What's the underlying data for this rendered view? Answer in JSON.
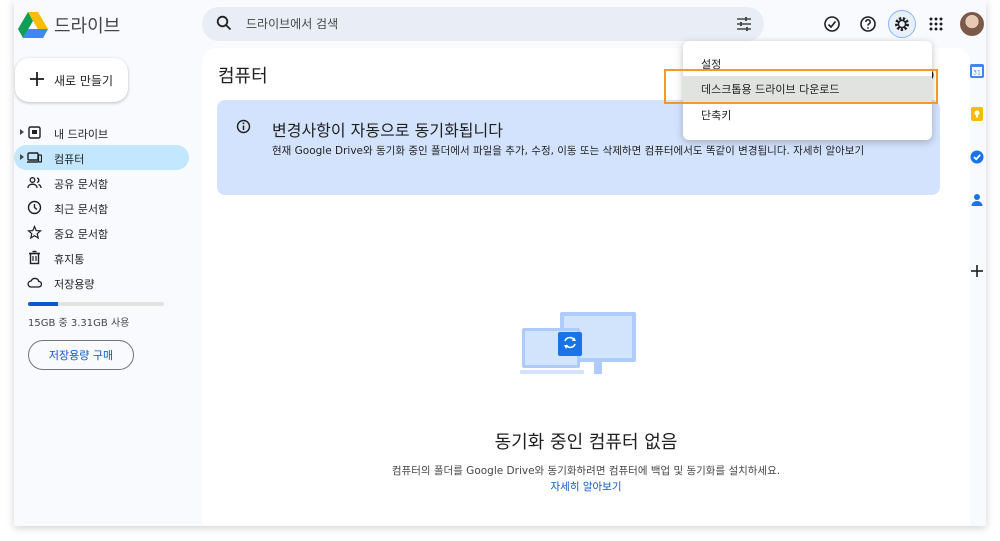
{
  "header": {
    "app_title": "드라이브",
    "search_placeholder": "드라이브에서 검색"
  },
  "sidebar": {
    "new_button": "새로 만들기",
    "items": [
      {
        "label": "내 드라이브",
        "icon": "my-drive-icon",
        "expandable": true
      },
      {
        "label": "컴퓨터",
        "icon": "computer-icon",
        "expandable": true,
        "active": true
      },
      {
        "label": "공유 문서함",
        "icon": "people-icon"
      },
      {
        "label": "최근 문서함",
        "icon": "clock-icon"
      },
      {
        "label": "중요 문서함",
        "icon": "star-icon"
      },
      {
        "label": "휴지통",
        "icon": "trash-icon"
      },
      {
        "label": "저장용량",
        "icon": "cloud-icon"
      }
    ],
    "storage_fraction": 0.22,
    "storage_text": "15GB 중 3.31GB 사용",
    "buy_storage": "저장용량 구매"
  },
  "main": {
    "title": "컴퓨터",
    "banner": {
      "title": "변경사항이 자동으로 동기화됩니다",
      "body": "현재 Google Drive와 동기화 중인 폴더에서 파일을 추가, 수정, 이동 또는 삭제하면 컴퓨터에서도 똑같이 변경됩니다. 자세히 알아보기"
    },
    "empty_title": "동기화 중인 컴퓨터 없음",
    "empty_desc": "컴퓨터의 폴더를 Google Drive와 동기화하려면 컴퓨터에 백업 및 동기화를 설치하세요.",
    "learn_more": "자세히 알아보기"
  },
  "settings_menu": {
    "items": [
      "설정",
      "데스크톱용 드라이브 다운로드",
      "단축키"
    ],
    "highlighted_index": 1
  },
  "colors": {
    "accent": "#0b57d0",
    "active_nav": "#c2e7ff",
    "banner_bg": "#d3e3fd",
    "highlight": "#f29a22"
  }
}
